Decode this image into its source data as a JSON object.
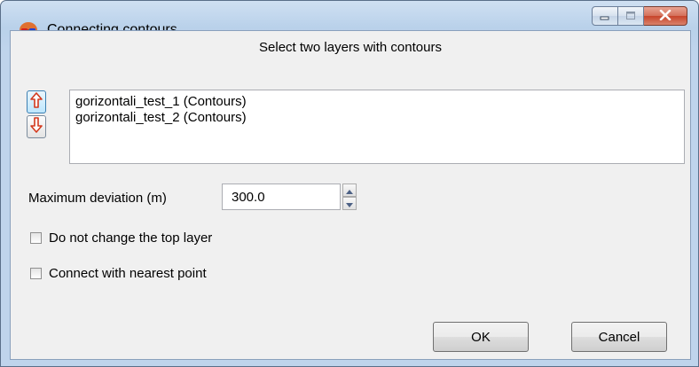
{
  "window": {
    "title": "Connecting contours",
    "icon": "3d-glasses-icon"
  },
  "caption_buttons": [
    "minimize-icon",
    "maximize-icon",
    "close-icon"
  ],
  "dialog": {
    "heading": "Select two layers with contours",
    "layers": [
      "gorizontali_test_1 (Contours)",
      "gorizontali_test_2 (Contours)"
    ],
    "move_up_icon": "arrow-up-icon",
    "move_down_icon": "arrow-down-icon",
    "max_deviation": {
      "label": "Maximum deviation (m)",
      "value": "300.0"
    },
    "options": [
      {
        "label": "Do not change the top layer",
        "checked": false
      },
      {
        "label": "Connect with nearest point",
        "checked": false
      }
    ],
    "buttons": {
      "ok": "OK",
      "cancel": "Cancel"
    },
    "colors": {
      "arrow": "#d3391d",
      "title_bar": "#b9d1ea",
      "close_button": "#c7442a"
    }
  }
}
